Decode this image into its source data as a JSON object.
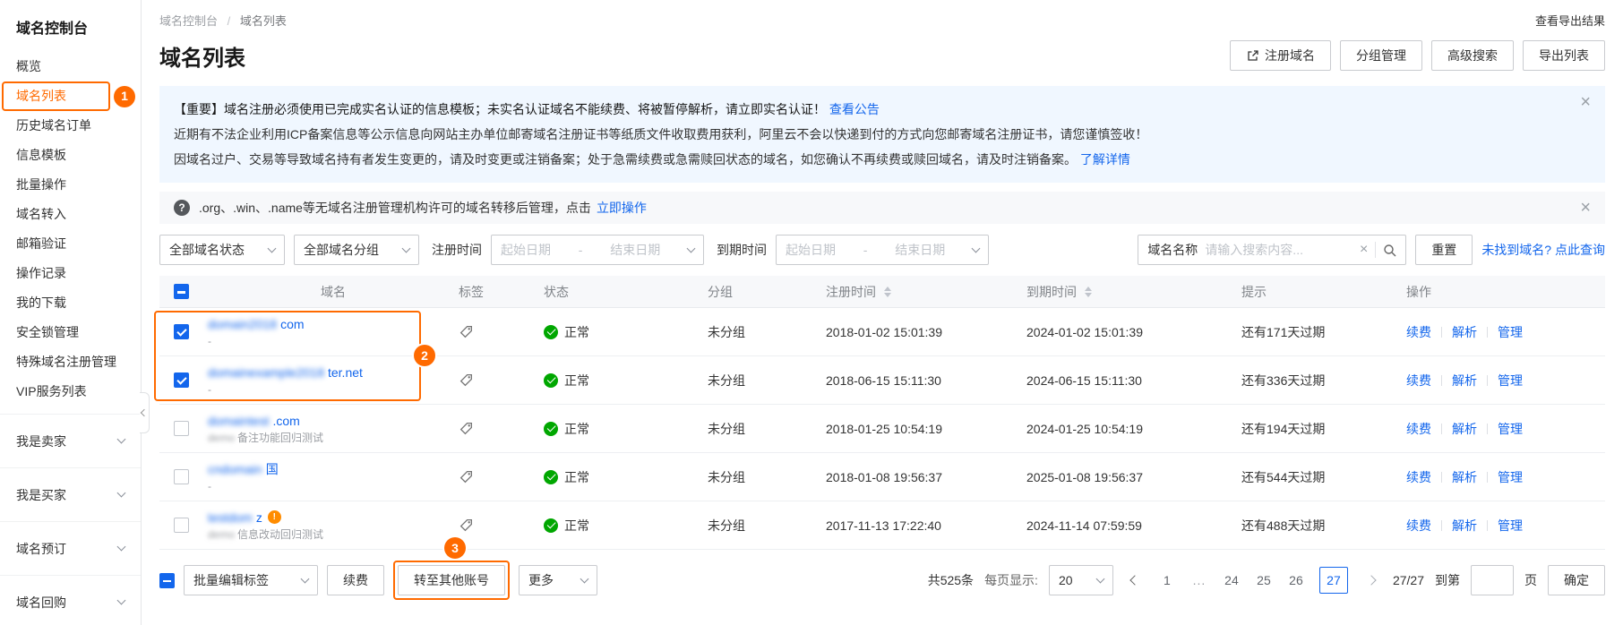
{
  "colors": {
    "accent_orange": "#FF6A00",
    "link_blue": "#1366EC",
    "success_green": "#00A700",
    "notice_bg": "#F0F7FF"
  },
  "annotations": {
    "badge1": "1",
    "badge2": "2",
    "badge3": "3"
  },
  "sidebar": {
    "title": "域名控制台",
    "items": [
      {
        "label": "概览",
        "active": false
      },
      {
        "label": "域名列表",
        "active": true
      },
      {
        "label": "历史域名订单",
        "active": false
      },
      {
        "label": "信息模板",
        "active": false
      },
      {
        "label": "批量操作",
        "active": false
      },
      {
        "label": "域名转入",
        "active": false
      },
      {
        "label": "邮箱验证",
        "active": false
      },
      {
        "label": "操作记录",
        "active": false
      },
      {
        "label": "我的下载",
        "active": false
      },
      {
        "label": "安全锁管理",
        "active": false
      },
      {
        "label": "特殊域名注册管理",
        "active": false
      },
      {
        "label": "VIP服务列表",
        "active": false
      }
    ],
    "groups": [
      {
        "label": "我是卖家"
      },
      {
        "label": "我是买家"
      },
      {
        "label": "域名预订"
      },
      {
        "label": "域名回购"
      }
    ]
  },
  "header": {
    "breadcrumb": [
      "域名控制台",
      "域名列表"
    ],
    "export_result_link": "查看导出结果",
    "page_title": "域名列表",
    "actions": [
      "注册域名",
      "分组管理",
      "高级搜索",
      "导出列表"
    ]
  },
  "notices": {
    "main": {
      "line1_bold": "【重要】域名注册必须使用已完成实名认证的信息模板；未实名认证域名不能续费、将被暂停解析，请立即实名认证！",
      "line1_link": "查看公告",
      "line2": "近期有不法企业利用ICP备案信息等公示信息向网站主办单位邮寄域名注册证书等纸质文件收取费用获利，阿里云不会以快递到付的方式向您邮寄域名注册证书，请您谨慎签收！",
      "line3": "因域名过户、交易等导致域名持有者发生变更的，请及时变更或注销备案；处于急需续费或急需赎回状态的域名，如您确认不再续费或赎回域名，请及时注销备案。",
      "line3_link": "了解详情"
    },
    "transfer": {
      "text": ".org、.win、.name等无域名注册管理机构许可的域名转移后管理，点击",
      "link": "立即操作"
    }
  },
  "filters": {
    "status_dropdown": "全部域名状态",
    "group_dropdown": "全部域名分组",
    "reg_time_label": "注册时间",
    "expire_time_label": "到期时间",
    "date_start_placeholder": "起始日期",
    "date_end_placeholder": "结束日期",
    "domain_label": "域名名称",
    "search_placeholder": "请输入搜索内容...",
    "reset_button": "重置",
    "not_found_link": "未找到域名? 点此查询"
  },
  "table": {
    "columns": [
      "域名",
      "标签",
      "状态",
      "分组",
      "注册时间",
      "到期时间",
      "提示",
      "操作"
    ],
    "row_actions": [
      "续费",
      "解析",
      "管理"
    ],
    "rows": [
      {
        "checked": true,
        "redacted": "domain2018",
        "suffix": "com",
        "badge": false,
        "sub_redacted": "",
        "subtext": "-",
        "status": "正常",
        "group": "未分组",
        "reg_time": "2018-01-02 15:01:39",
        "expire_time": "2024-01-02 15:01:39",
        "tip": "还有171天过期"
      },
      {
        "checked": true,
        "redacted": "domainexample2018",
        "suffix": "ter.net",
        "badge": false,
        "sub_redacted": "",
        "subtext": "-",
        "status": "正常",
        "group": "未分组",
        "reg_time": "2018-06-15 15:11:30",
        "expire_time": "2024-06-15 15:11:30",
        "tip": "还有336天过期"
      },
      {
        "checked": false,
        "redacted": "domaintest",
        "suffix": ".com",
        "badge": false,
        "sub_redacted": "demo",
        "subtext": "备注功能回归测试",
        "status": "正常",
        "group": "未分组",
        "reg_time": "2018-01-25 10:54:19",
        "expire_time": "2024-01-25 10:54:19",
        "tip": "还有194天过期"
      },
      {
        "checked": false,
        "redacted": "cndomain",
        "suffix": "国",
        "badge": false,
        "sub_redacted": "",
        "subtext": "-",
        "status": "正常",
        "group": "未分组",
        "reg_time": "2018-01-08 19:56:37",
        "expire_time": "2025-01-08 19:56:37",
        "tip": "还有544天过期"
      },
      {
        "checked": false,
        "redacted": "testdom",
        "suffix": "z",
        "badge": true,
        "sub_redacted": "demo",
        "subtext": "信息改动回归测试",
        "status": "正常",
        "group": "未分组",
        "reg_time": "2017-11-13 17:22:40",
        "expire_time": "2024-11-14 07:59:59",
        "tip": "还有488天过期"
      }
    ]
  },
  "bottom": {
    "batch_edit_tag": "批量编辑标签",
    "renew_button": "续费",
    "transfer_button": "转至其他账号",
    "more_button": "更多",
    "total": "共525条",
    "per_page_label": "每页显示:",
    "per_page_value": "20",
    "pages": [
      {
        "label": "1",
        "current": false
      },
      {
        "label": "...",
        "current": false
      },
      {
        "label": "24",
        "current": false
      },
      {
        "label": "25",
        "current": false
      },
      {
        "label": "26",
        "current": false
      },
      {
        "label": "27",
        "current": true
      }
    ],
    "page_indicator": "27/27",
    "goto_label": "到第",
    "goto_unit": "页",
    "confirm_button": "确定"
  }
}
